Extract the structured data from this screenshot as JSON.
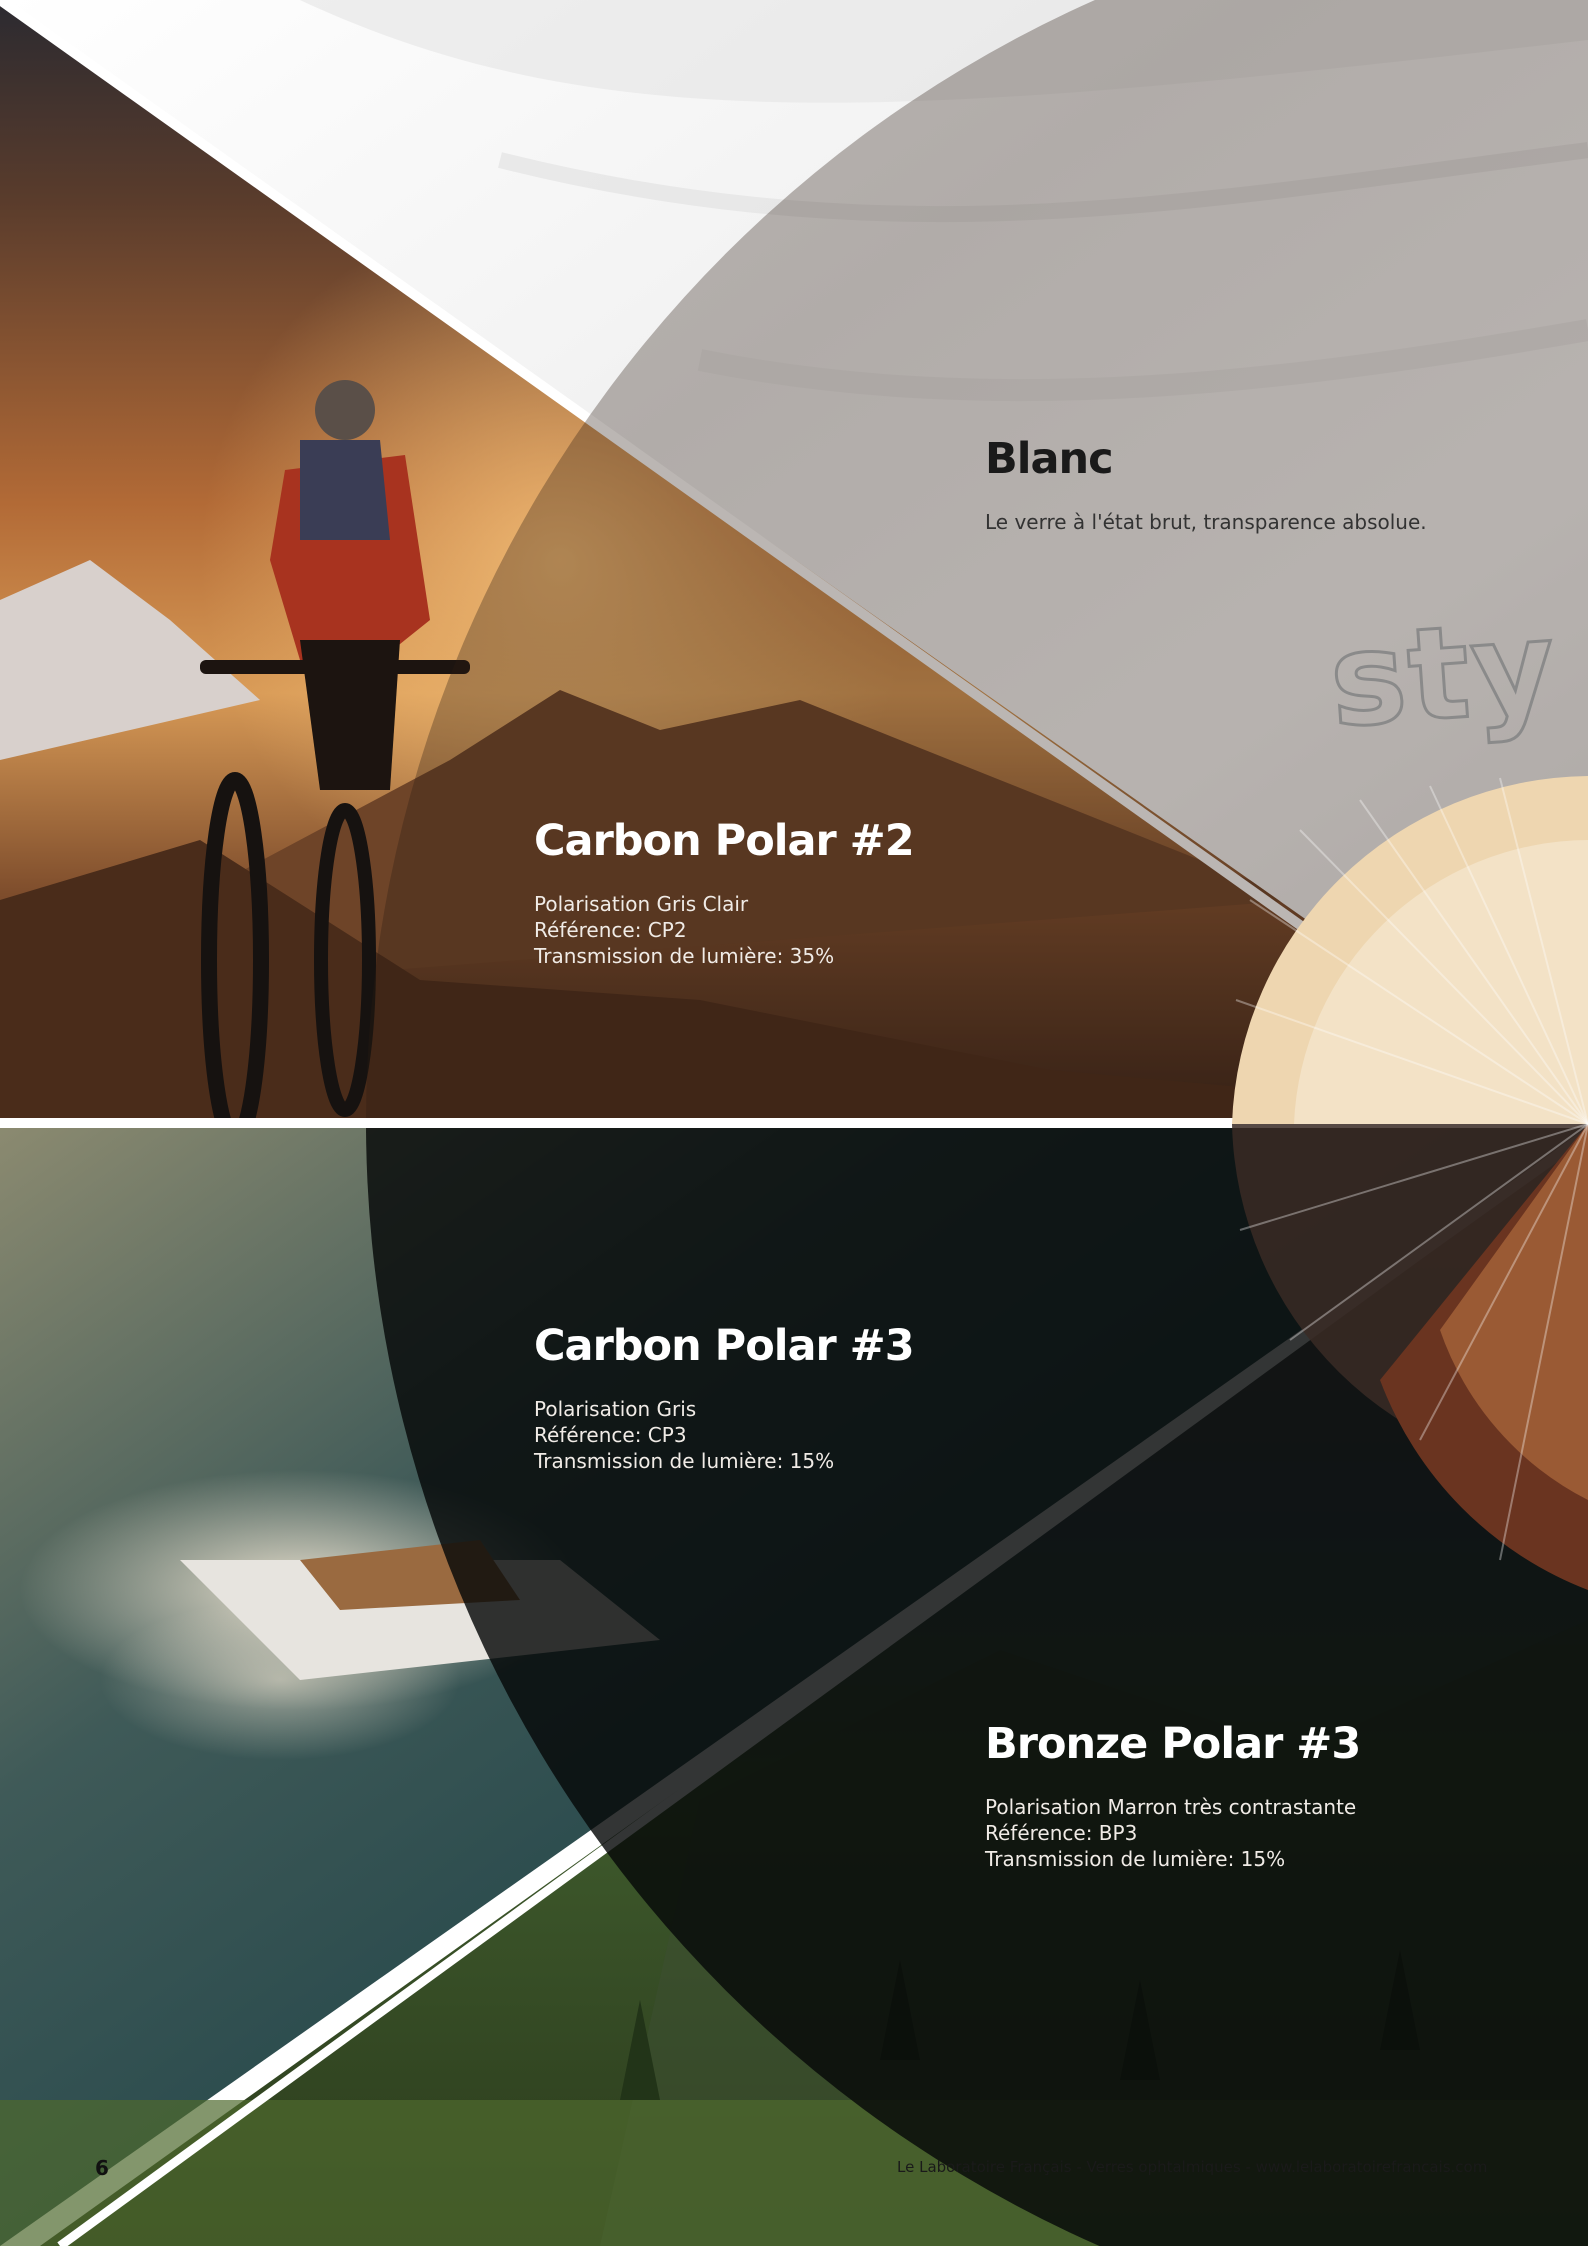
{
  "lenses": {
    "blanc": {
      "name": "Blanc",
      "lines": [
        "Le verre à l'état brut, transparence absolue."
      ]
    },
    "carbon_polar_2": {
      "name": "Carbon Polar #2",
      "lines": [
        "Polarisation Gris Clair",
        "Référence: CP2",
        "Transmission de lumière: 35%"
      ]
    },
    "carbon_polar_3": {
      "name": "Carbon Polar #3",
      "lines": [
        "Polarisation Gris",
        "Référence: CP3",
        "Transmission de lumière: 15%"
      ]
    },
    "bronze_polar_3": {
      "name": "Bronze Polar #3",
      "lines": [
        "Polarisation Marron très contrastante",
        "Référence: BP3",
        "Transmission de lumière: 15%"
      ]
    }
  },
  "brand_word": "sty",
  "page_number": "6",
  "footer": "Le Laboratoire Français - Verres ophtalmiques - www.lelaboratoirefrancais.com",
  "images": {
    "top_left": "mountain-biker-sunset-photo",
    "middle_left": "speedboat-ocean-photo",
    "bottom": "mountain-valley-forest-photo",
    "top_right": "white-silk-background-photo",
    "fan": "lens-color-swatch-fan"
  },
  "colors": {
    "white": "#ffffff",
    "sunset": "#c87a3c",
    "ocean": "#1e4a50",
    "forest": "#3e5a2c",
    "dark_overlay": "#0c0c0c"
  }
}
